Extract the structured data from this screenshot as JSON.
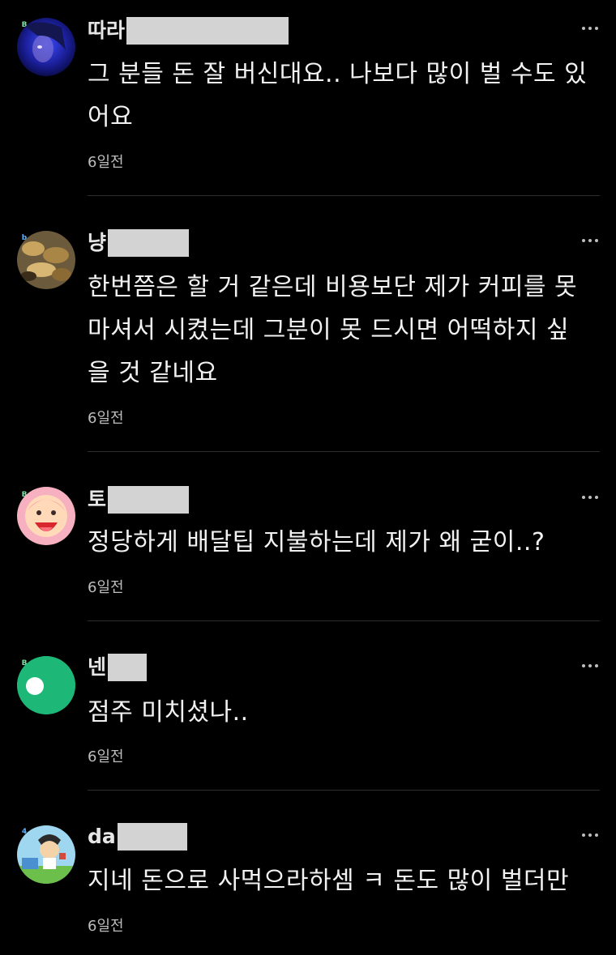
{
  "comments": [
    {
      "name": "따라",
      "text_lines": [
        "그 분들 돈 잘 버신대요.. 나보다 많이 벌 수도 있",
        "어요"
      ],
      "time": "6일전",
      "badge": "B",
      "badge_color": "#7fe0a8"
    },
    {
      "name": "냥",
      "text_lines": [
        "한번쯤은 할 거 같은데 비용보단 제가 커피를 못",
        "마셔서 시켰는데 그분이 못 드시면 어떡하지 싶",
        "을 것 같네요"
      ],
      "time": "6일전",
      "badge": "b",
      "badge_color": "#5fb3ff"
    },
    {
      "name": "토",
      "text_lines": [
        "정당하게 배달팁 지불하는데 제가 왜 굳이..?"
      ],
      "time": "6일전",
      "badge": "B",
      "badge_color": "#7fe0a8"
    },
    {
      "name": "넨",
      "text_lines": [
        "점주 미치셨나.."
      ],
      "time": "6일전",
      "badge": "B",
      "badge_color": "#7fe0a8"
    },
    {
      "name": "da",
      "text_lines": [
        "지네 돈으로 사먹으라하셈 ㅋ 돈도 많이 벌더만"
      ],
      "time": "6일전",
      "badge": "4",
      "badge_color": "#5fb3ff"
    }
  ],
  "colors": {
    "background": "#000000",
    "text": "#f2f2f2",
    "meta": "#bdbdbd",
    "redaction": "#d3d3d3",
    "divider": "#2e2e2e",
    "green_avatar": "#1db877"
  }
}
